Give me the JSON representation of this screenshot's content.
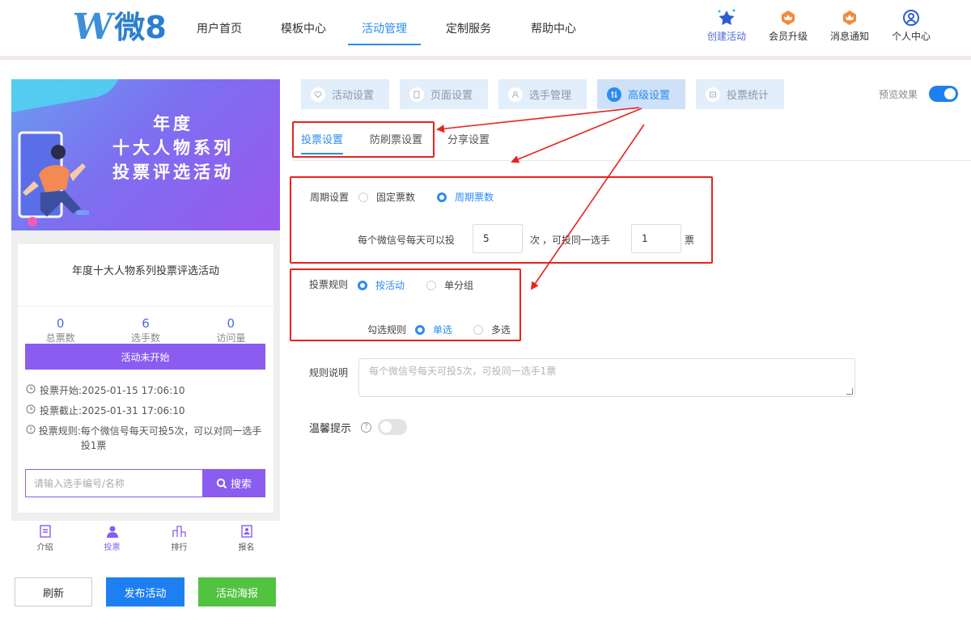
{
  "header": {
    "logo_text": "微8",
    "nav": [
      {
        "label": "用户首页",
        "active": false
      },
      {
        "label": "模板中心",
        "active": false
      },
      {
        "label": "活动管理",
        "active": true
      },
      {
        "label": "定制服务",
        "active": false
      },
      {
        "label": "帮助中心",
        "active": false
      }
    ],
    "tools": [
      {
        "label": "创建活动",
        "icon": "star-icon"
      },
      {
        "label": "会员升级",
        "icon": "crown-badge-icon"
      },
      {
        "label": "消息通知",
        "icon": "crown-badge-icon"
      },
      {
        "label": "个人中心",
        "icon": "user-circle-icon"
      }
    ]
  },
  "preview": {
    "banner_lines": [
      "年度",
      "十大人物系列",
      "投票评选活动"
    ],
    "activity_title": "年度十大人物系列投票评选活动",
    "stats": [
      {
        "value": "0",
        "caption": "总票数"
      },
      {
        "value": "6",
        "caption": "选手数"
      },
      {
        "value": "0",
        "caption": "访问量"
      }
    ],
    "status": "活动未开始",
    "info": [
      {
        "icon": "clock-icon",
        "label": "投票开始:",
        "value": "2025-01-15 17:06:10"
      },
      {
        "icon": "clock-icon",
        "label": "投票截止:",
        "value": "2025-01-31 17:06:10"
      },
      {
        "icon": "info-icon",
        "label": "投票规则:",
        "value": "每个微信号每天可投5次，可以对同一选手投1票"
      }
    ],
    "search_placeholder": "请输入选手编号/名称",
    "search_button": "搜索",
    "tabbar": [
      {
        "label": "介绍",
        "icon": "document-icon",
        "active": false
      },
      {
        "label": "投票",
        "icon": "person-icon",
        "active": true
      },
      {
        "label": "排行",
        "icon": "bar-chart-icon",
        "active": false
      },
      {
        "label": "报名",
        "icon": "signup-icon",
        "active": false
      }
    ]
  },
  "actions": {
    "refresh": "刷新",
    "publish": "发布活动",
    "poster": "活动海报"
  },
  "steps": [
    {
      "label": "活动设置",
      "icon": "heart-icon",
      "active": false
    },
    {
      "label": "页面设置",
      "icon": "page-icon",
      "active": false
    },
    {
      "label": "选手管理",
      "icon": "user-icon",
      "active": false
    },
    {
      "label": "高级设置",
      "icon": "sliders-icon",
      "active": true
    },
    {
      "label": "投票统计",
      "icon": "stats-icon",
      "active": false
    }
  ],
  "preview_toggle": {
    "label": "预览效果",
    "on": true
  },
  "subtabs": [
    {
      "label": "投票设置",
      "active": true
    },
    {
      "label": "防刷票设置",
      "active": false
    },
    {
      "label": "分享设置",
      "active": false
    }
  ],
  "cycle": {
    "label": "周期设置",
    "options": [
      {
        "label": "固定票数",
        "selected": false
      },
      {
        "label": "周期票数",
        "selected": true
      }
    ],
    "per_day_prefix": "每个微信号每天可以投",
    "per_day_value": "5",
    "per_day_unit": "次",
    "same_prefix": "，可投同一选手",
    "same_value": "1",
    "same_unit": "票"
  },
  "rule": {
    "label": "投票规则",
    "options": [
      {
        "label": "按活动",
        "selected": true
      },
      {
        "label": "单分组",
        "selected": false
      }
    ],
    "select_label": "勾选规则",
    "select_options": [
      {
        "label": "单选",
        "selected": true
      },
      {
        "label": "多选",
        "selected": false
      }
    ]
  },
  "description": {
    "label": "规则说明",
    "placeholder": "每个微信号每天可投5次，可投同一选手1票"
  },
  "tip": {
    "label": "温馨提示",
    "on": false
  },
  "colors": {
    "accent": "#2d8cf0",
    "purple": "#8a5cf0",
    "annotation": "#e8231e",
    "green": "#52c241"
  }
}
